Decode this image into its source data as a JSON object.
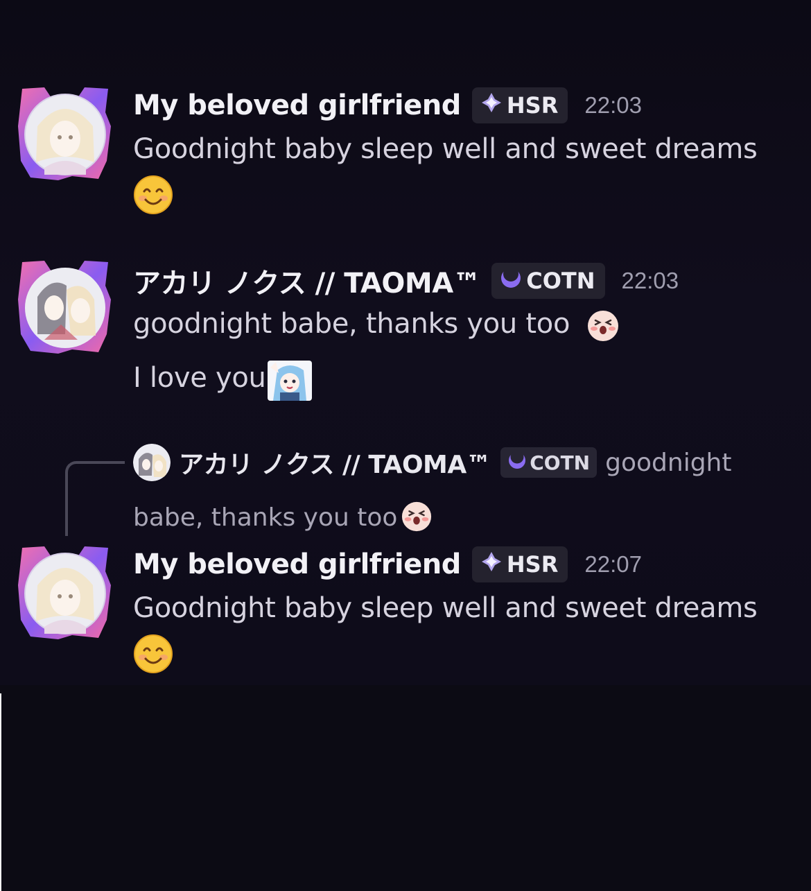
{
  "messages": [
    {
      "author": "My beloved girlfriend",
      "tag": "HSR",
      "tag_icon": "diamond-sparkle-icon",
      "time": "22:03",
      "lines": [
        "Goodnight baby sleep well and sweet dreams"
      ],
      "trailing_emoji": "smiling-face-emoji"
    },
    {
      "author": "アカリ ノクス // TAOMA™",
      "tag": "COTN",
      "tag_icon": "crescent-moon-icon",
      "time": "22:03",
      "lines": [
        "goodnight babe, thanks you too",
        "I love you"
      ],
      "emojis": [
        "shocked-pink-face-emoji",
        "waving-anime-girl-emoji"
      ]
    },
    {
      "author": "My beloved girlfriend",
      "tag": "HSR",
      "tag_icon": "diamond-sparkle-icon",
      "time": "22:07",
      "lines": [
        "Goodnight baby sleep well and sweet dreams"
      ],
      "trailing_emoji": "smiling-face-emoji",
      "reply_to": {
        "author": "アカリ ノクス // TAOMA™",
        "tag": "COTN",
        "text_part1": "goodnight",
        "text_part2": "babe, thanks you too"
      }
    }
  ],
  "colors": {
    "background": "#0f0d18",
    "username": "#f2f1f6",
    "message_text": "#d6d3df",
    "timestamp": "#a09eaf",
    "tag_bg": "#24222e",
    "moon_purple": "#8a6cf0",
    "avatar_pink": "#f06fb0",
    "avatar_purple": "#8a5cf0"
  }
}
